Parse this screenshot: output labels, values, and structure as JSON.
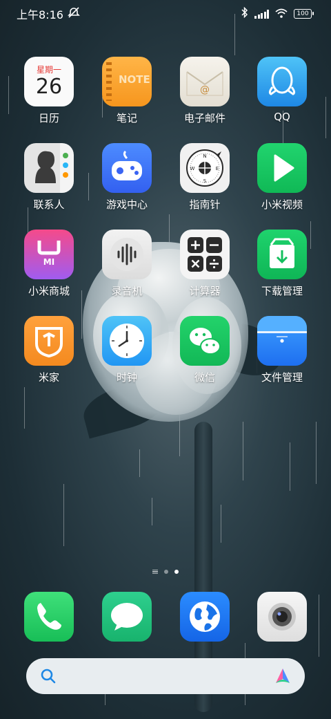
{
  "status_bar": {
    "time": "上午8:16",
    "battery": "100"
  },
  "apps": [
    {
      "name": "calendar",
      "label": "日历",
      "weekday": "星期一",
      "day": "26"
    },
    {
      "name": "notes",
      "label": "笔记",
      "icon_text": "NOTE"
    },
    {
      "name": "email",
      "label": "电子邮件"
    },
    {
      "name": "qq",
      "label": "QQ"
    },
    {
      "name": "contacts",
      "label": "联系人"
    },
    {
      "name": "game-center",
      "label": "游戏中心"
    },
    {
      "name": "compass",
      "label": "指南针"
    },
    {
      "name": "mi-video",
      "label": "小米视频"
    },
    {
      "name": "mi-store",
      "label": "小米商城",
      "icon_text": "MI"
    },
    {
      "name": "recorder",
      "label": "录音机"
    },
    {
      "name": "calculator",
      "label": "计算器"
    },
    {
      "name": "downloads",
      "label": "下载管理"
    },
    {
      "name": "mi-home",
      "label": "米家"
    },
    {
      "name": "clock",
      "label": "时钟"
    },
    {
      "name": "wechat",
      "label": "微信"
    },
    {
      "name": "file-manager",
      "label": "文件管理"
    }
  ],
  "dock": [
    "phone",
    "messages",
    "browser",
    "camera"
  ],
  "page_indicator": {
    "pages": 2,
    "active": 2
  },
  "colors": {
    "accent": "#1e88e5",
    "search_bg": "#e8edf0"
  }
}
